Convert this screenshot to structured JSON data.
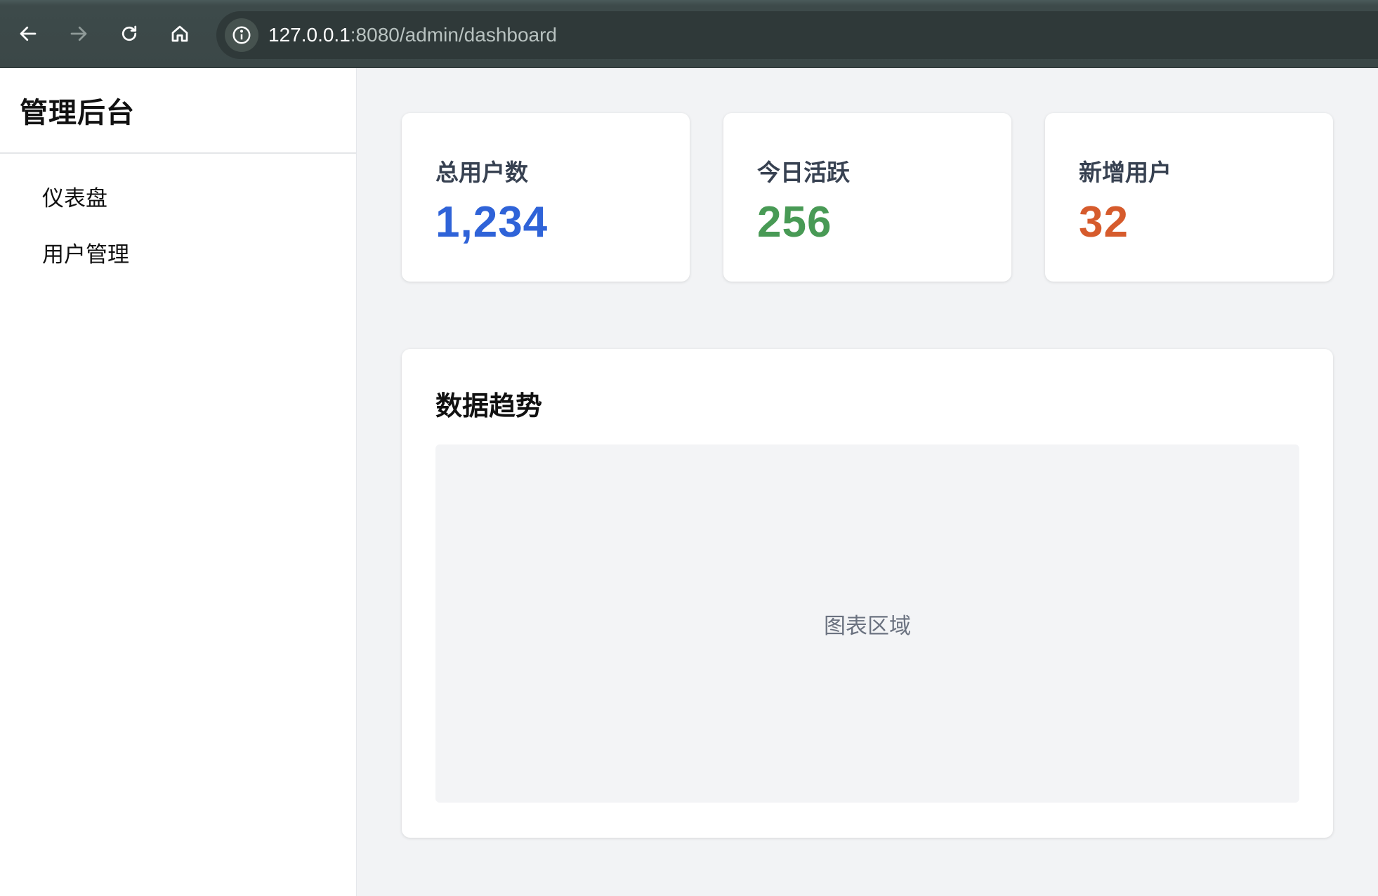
{
  "browser": {
    "url_host": "127.0.0.1",
    "url_rest": ":8080/admin/dashboard",
    "icons": {
      "back": "arrow-left-icon",
      "forward": "arrow-right-icon",
      "reload": "reload-icon",
      "home": "home-icon",
      "site_info": "info-icon"
    }
  },
  "sidebar": {
    "title": "管理后台",
    "items": [
      {
        "label": "仪表盘"
      },
      {
        "label": "用户管理"
      }
    ]
  },
  "stats": [
    {
      "label": "总用户数",
      "value": "1,234",
      "color": "#2f63d8"
    },
    {
      "label": "今日活跃",
      "value": "256",
      "color": "#489a55"
    },
    {
      "label": "新增用户",
      "value": "32",
      "color": "#d65b2c"
    }
  ],
  "chart": {
    "title": "数据趋势",
    "placeholder": "图表区域"
  }
}
